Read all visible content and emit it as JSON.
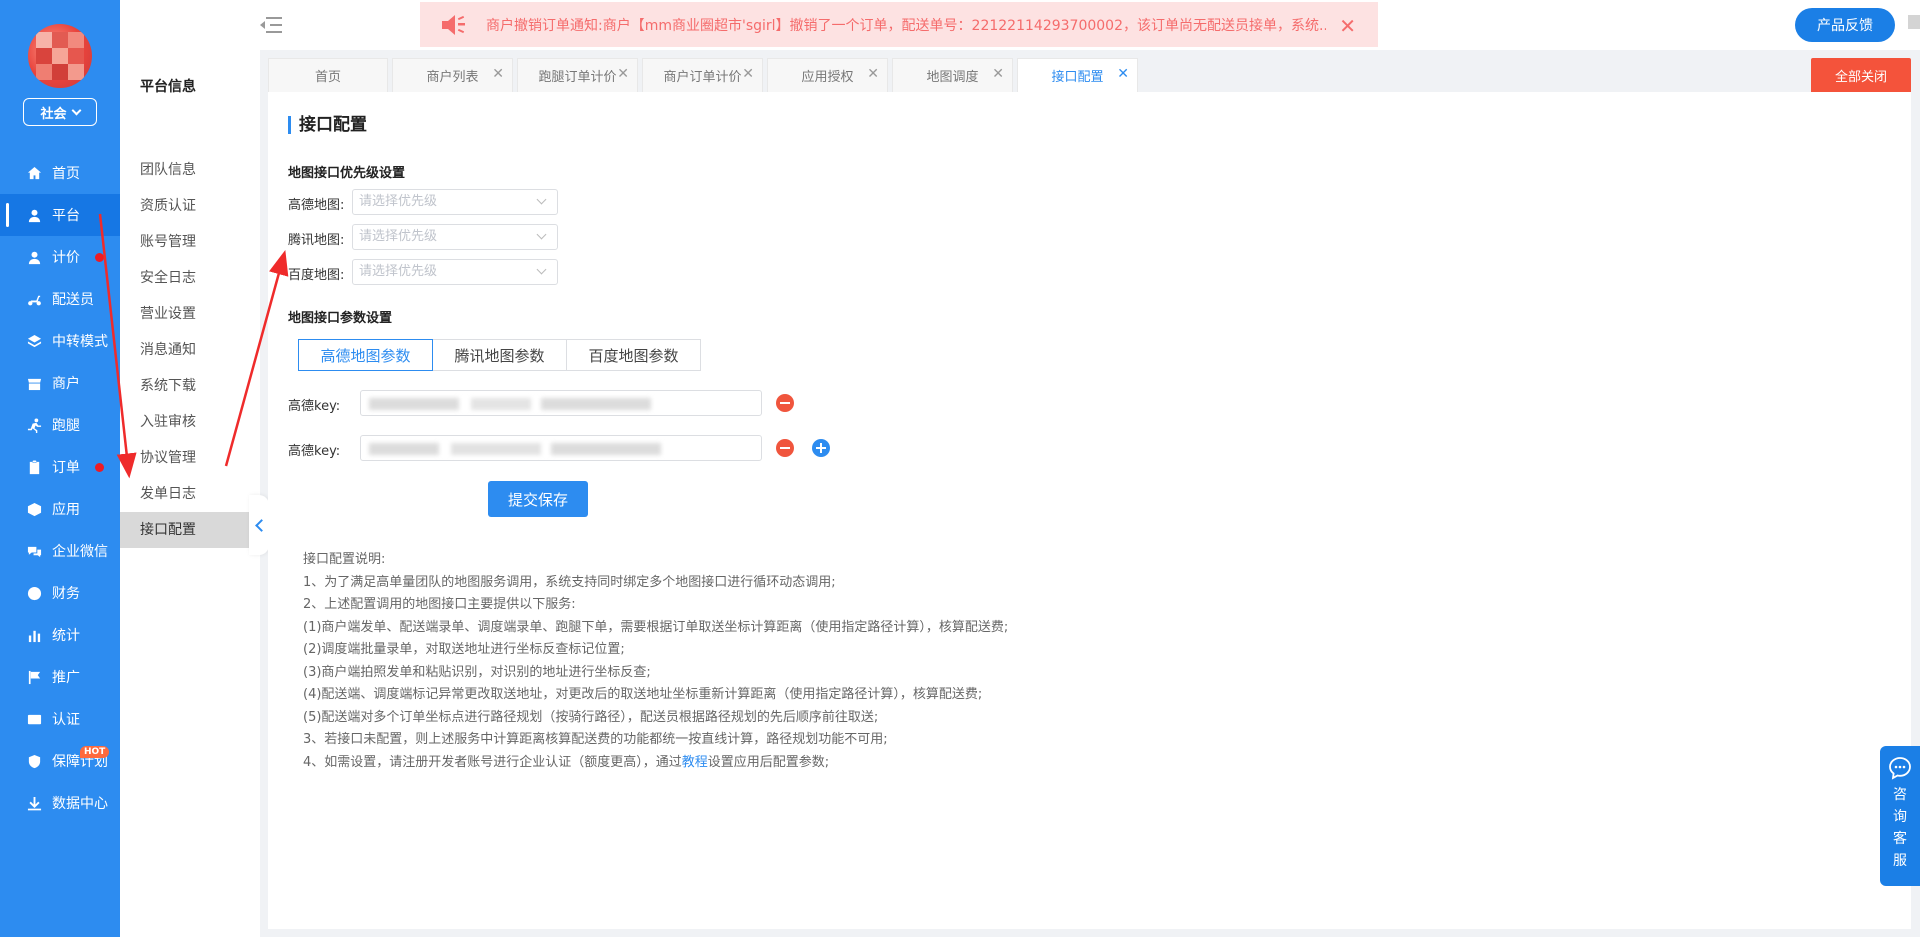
{
  "sidebar": {
    "org_label": "社会",
    "items": [
      {
        "label": "首页",
        "icon": "home-icon"
      },
      {
        "label": "平台",
        "icon": "user-icon",
        "active": true
      },
      {
        "label": "计价",
        "icon": "user-icon",
        "dot": true
      },
      {
        "label": "配送员",
        "icon": "scooter-icon"
      },
      {
        "label": "中转模式",
        "icon": "layers-icon"
      },
      {
        "label": "商户",
        "icon": "store-icon"
      },
      {
        "label": "跑腿",
        "icon": "runner-icon"
      },
      {
        "label": "订单",
        "icon": "clipboard-icon",
        "dot": true
      },
      {
        "label": "应用",
        "icon": "box-icon"
      },
      {
        "label": "企业微信",
        "icon": "chat-icon"
      },
      {
        "label": "财务",
        "icon": "yen-icon"
      },
      {
        "label": "统计",
        "icon": "bar-chart-icon"
      },
      {
        "label": "推广",
        "icon": "flag-icon"
      },
      {
        "label": "认证",
        "icon": "id-card-icon"
      },
      {
        "label": "保障计划",
        "icon": "shield-icon",
        "badge": "HOT"
      },
      {
        "label": "数据中心",
        "icon": "download-icon"
      }
    ]
  },
  "submenu": {
    "title": "平台信息",
    "items": [
      "团队信息",
      "资质认证",
      "账号管理",
      "安全日志",
      "营业设置",
      "消息通知",
      "系统下载",
      "入驻审核",
      "协议管理",
      "发单日志",
      "接口配置"
    ],
    "active_index": 10
  },
  "header": {
    "notice": "商户撤销订单通知:商户【mm商业圈超市'sgirl】撤销了一个订单，配送单号：22122114293700002，该订单尚无配送员接单，系统...",
    "feedback_label": "产品反馈"
  },
  "tabs": {
    "items": [
      {
        "label": "首页",
        "closable": false
      },
      {
        "label": "商户列表",
        "closable": true
      },
      {
        "label": "跑腿订单计价",
        "closable": true
      },
      {
        "label": "商户订单计价",
        "closable": true
      },
      {
        "label": "应用授权",
        "closable": true
      },
      {
        "label": "地图调度",
        "closable": true
      },
      {
        "label": "接口配置",
        "closable": true,
        "active": true
      }
    ],
    "close_all_label": "全部关闭"
  },
  "main": {
    "title": "接口配置",
    "priority_section": "地图接口优先级设置",
    "priority_rows": [
      {
        "label": "高德地图:",
        "placeholder": "请选择优先级"
      },
      {
        "label": "腾讯地图:",
        "placeholder": "请选择优先级"
      },
      {
        "label": "百度地图:",
        "placeholder": "请选择优先级"
      }
    ],
    "params_section": "地图接口参数设置",
    "map_tabs": [
      "高德地图参数",
      "腾讯地图参数",
      "百度地图参数"
    ],
    "active_map_tab": 0,
    "key_rows": [
      {
        "label": "高德key:"
      },
      {
        "label": "高德key:"
      }
    ],
    "save_label": "提交保存",
    "notes": {
      "title": "接口配置说明:",
      "lines": [
        "1、为了满足高单量团队的地图服务调用，系统支持同时绑定多个地图接口进行循环动态调用;",
        "2、上述配置调用的地图接口主要提供以下服务:",
        "(1)商户端发单、配送端录单、调度端录单、跑腿下单，需要根据订单取送坐标计算距离（使用指定路径计算），核算配送费;",
        "(2)调度端批量录单，对取送地址进行坐标反查标记位置;",
        "(3)商户端拍照发单和粘贴识别，对识别的地址进行坐标反查;",
        "(4)配送端、调度端标记异常更改取送地址，对更改后的取送地址坐标重新计算距离（使用指定路径计算），核算配送费;",
        "(5)配送端对多个订单坐标点进行路径规划（按骑行路径），配送员根据路径规划的先后顺序前往取送;",
        "3、若接口未配置，则上述服务中计算距离核算配送费的功能都统一按直线计算，路径规划功能不可用;"
      ],
      "last_prefix": "4、如需设置，请注册开发者账号进行企业认证（额度更高），通过",
      "last_link": "教程",
      "last_suffix": "设置应用后配置参数;"
    }
  },
  "consult": {
    "label": "咨询客服"
  }
}
